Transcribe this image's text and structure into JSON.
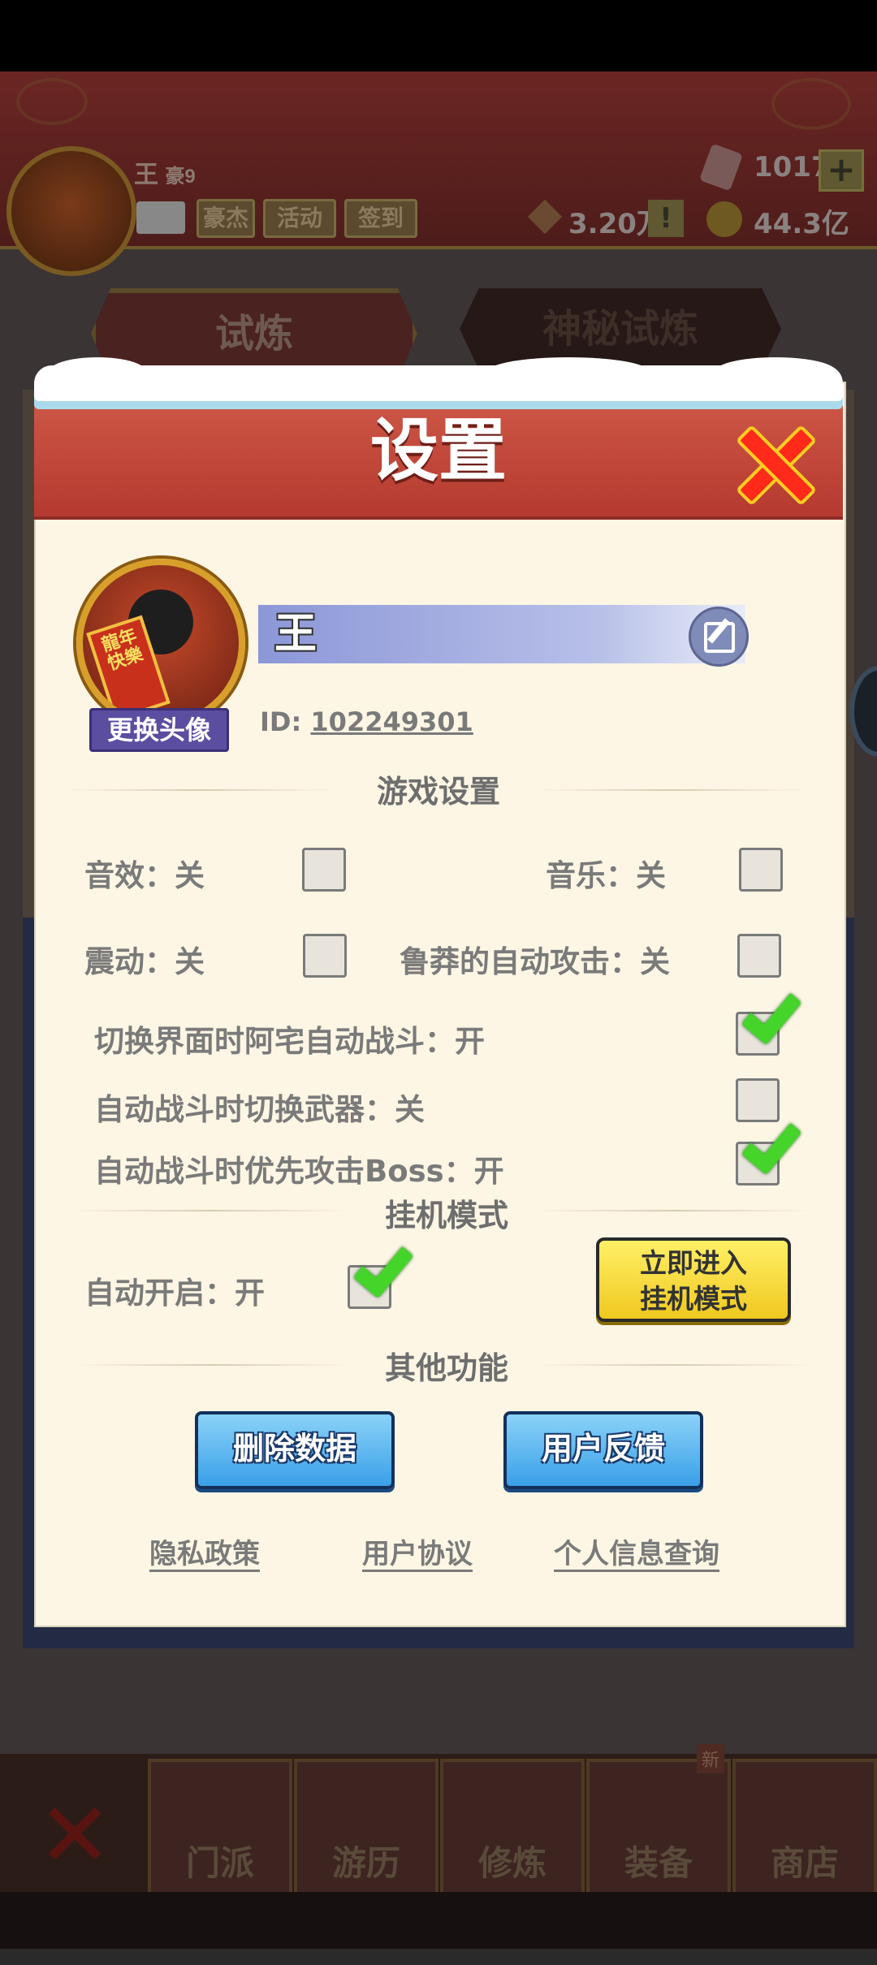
{
  "player": {
    "name": "王",
    "level": "豪9",
    "id_label": "ID:",
    "id_value": "102249301"
  },
  "topbar": {
    "tags": [
      "豪杰",
      "活动",
      "签到"
    ],
    "gems": "1017",
    "plus": "+",
    "power": "3.20万",
    "alert": "!",
    "gold": "44.3亿"
  },
  "tabs": [
    "试炼",
    "神秘试炼"
  ],
  "dialog": {
    "title": "设置",
    "change_avatar": "更换头像",
    "avatar_scroll_text": "龍年快樂",
    "sections": {
      "game": "游戏设置",
      "idle": "挂机模式",
      "other": "其他功能"
    },
    "options": [
      {
        "label": "音效：关",
        "checked": false
      },
      {
        "label": "音乐：关",
        "checked": false
      },
      {
        "label": "震动：关",
        "checked": false
      },
      {
        "label": "鲁莽的自动攻击：关",
        "checked": false
      },
      {
        "label": "切换界面时阿宅自动战斗：开",
        "checked": true
      },
      {
        "label": "自动战斗时切换武器：关",
        "checked": false
      },
      {
        "label": "自动战斗时优先攻击Boss：开",
        "checked": true
      }
    ],
    "idle": {
      "auto_label": "自动开启：开",
      "auto_checked": true,
      "enter_button_line1": "立即进入",
      "enter_button_line2": "挂机模式"
    },
    "buttons": {
      "delete": "删除数据",
      "feedback": "用户反馈"
    },
    "links": [
      "隐私政策",
      "用户协议",
      "个人信息查询"
    ]
  },
  "nav": {
    "items": [
      "门派",
      "游历",
      "修炼",
      "装备",
      "商店"
    ],
    "new_badge": "新"
  },
  "colors": {
    "header_red": "#b5392f",
    "dialog_bg": "#fdf6e4",
    "check_green": "#44d42a",
    "button_blue": "#3aa0e8",
    "button_yellow": "#f0c820"
  }
}
